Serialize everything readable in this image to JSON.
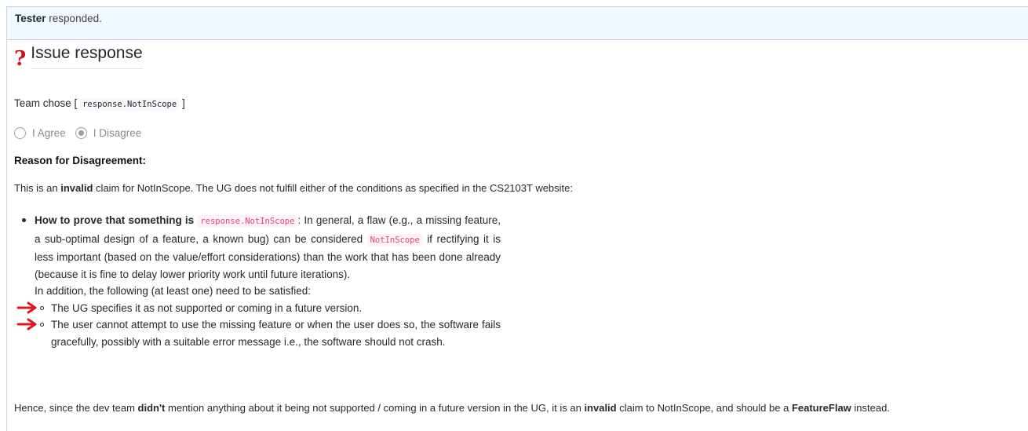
{
  "header": {
    "user": "Tester",
    "action": "responded."
  },
  "issue": {
    "title": "Issue response",
    "team_chose_prefix": "Team chose [",
    "team_chose_code": "response.NotInScope",
    "team_chose_suffix": "]"
  },
  "radios": [
    {
      "label": "I Agree",
      "checked": false
    },
    {
      "label": "I Disagree",
      "checked": true
    }
  ],
  "reason_heading": "Reason for Disagreement:",
  "para1": {
    "a": "This is an ",
    "b": "invalid",
    "c": " claim for NotInScope. The UG does not fulfill either of the conditions as specified in the CS2103T website:"
  },
  "bullet": {
    "bold": "How to prove that something is",
    "code1": "response.NotInScope",
    "t1": ": In general, a flaw (e.g., a missing feature, a sub-optimal design of a feature, a known bug) can be considered",
    "code2": "NotInScope",
    "t2": "if rectifying it is less important (based on the value/effort considerations) than the work that has been done already (because it is fine to delay lower priority work until future iterations).",
    "t3": "In addition, the following (at least one) need to be satisfied:",
    "sub": [
      "The UG specifies it as not supported or coming in a future version.",
      "The user cannot attempt to use the missing feature or when the user does so, the software fails gracefully, possibly with a suitable error message i.e., the software should not crash."
    ]
  },
  "conclusion": {
    "a": "Hence, since the dev team ",
    "b": "didn't",
    "c": " mention anything about it being not supported / coming in a future version in the UG, it is an ",
    "d": "invalid",
    "e": " claim to NotInScope, and should be a ",
    "f": "FeatureFlaw",
    "g": " instead."
  },
  "colors": {
    "arrow": "#e0171e",
    "qmark": "#d0121b",
    "header_bg": "#f1f8ff",
    "code_pink": "#e83e8c"
  },
  "icons": {
    "title_icon": "question-mark-icon",
    "annotation": "red-arrow-icon"
  }
}
